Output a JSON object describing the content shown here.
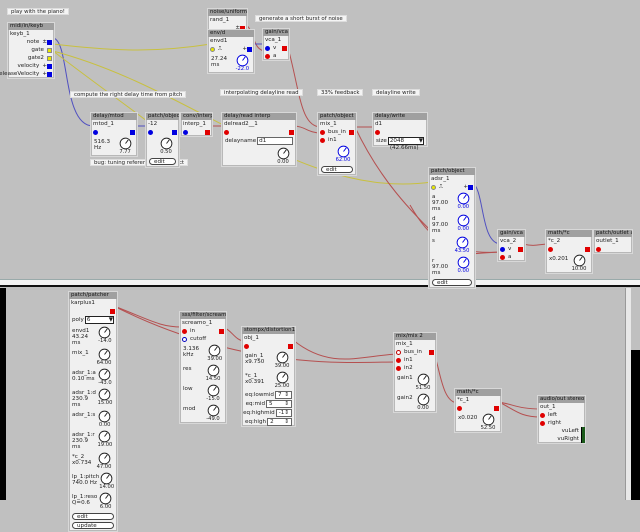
{
  "colors": {
    "background": "#c0c0c0",
    "object": "#f0f0f0",
    "title_bar": "#a0a0a0",
    "audio": "#e00000",
    "frac": "#0000e0",
    "bool": "#e8e800",
    "wire_audio": "#b55050",
    "wire_frac": "#5050c0",
    "wire_bool": "#c8c040"
  },
  "top_patch": {
    "comments": [
      "play with the piano!",
      "generate a short burst of noise",
      "compute the right delay time from pitch",
      "bug: tuning reference is incorrect",
      "interpolating delayline read",
      "33% feedback",
      "delayline write"
    ],
    "objects": [
      {
        "title": "midi/in/keyb",
        "instance": "keyb_1",
        "rows": [
          {
            "kind": "out",
            "label": "note",
            "port": "frac",
            "glyph": "±"
          },
          {
            "kind": "out",
            "label": "gate",
            "port": "bool"
          },
          {
            "kind": "out",
            "label": "gate2",
            "port": "bool"
          },
          {
            "kind": "out",
            "label": "velocity",
            "port": "frac",
            "glyph": "+"
          },
          {
            "kind": "out",
            "label": "releaseVelocity",
            "port": "frac",
            "glyph": "+"
          }
        ]
      },
      {
        "title": "noise/uniform",
        "instance": "rand_1",
        "rows": [
          {
            "kind": "out",
            "label": "",
            "port": "audio",
            "glyph": "±"
          }
        ]
      },
      {
        "title": "env/d",
        "instance": "envd1",
        "rows": [
          {
            "kind": "io",
            "in": "bool",
            "label": "⎍",
            "out": "frac",
            "glyph": "+"
          },
          {
            "kind": "knob",
            "label": "27.24 ms",
            "sub": "",
            "value": "-22.0",
            "blue": true
          }
        ]
      },
      {
        "title": "gain/vca",
        "instance": "vca_1",
        "rows": [
          {
            "kind": "io",
            "in": "frac",
            "label": "v",
            "out": "audio"
          },
          {
            "kind": "in",
            "label": "a",
            "port": "audio"
          }
        ]
      },
      {
        "title": "delay/mtod",
        "instance": "mtod_1",
        "rows": [
          {
            "kind": "io",
            "in": "frac",
            "label": "",
            "out": "frac"
          },
          {
            "kind": "knob",
            "label": "516.3 Hz",
            "sub": "",
            "value": "7.77"
          }
        ]
      },
      {
        "title": "patch/object",
        "instance": "-12",
        "rows": [
          {
            "kind": "io",
            "in": "frac",
            "label": "",
            "out": "frac"
          },
          {
            "kind": "knob",
            "label": "",
            "sub": "",
            "value": "0.50"
          },
          {
            "kind": "button",
            "label": "edit"
          }
        ]
      },
      {
        "title": "conv/interp",
        "instance": "interp_1",
        "rows": [
          {
            "kind": "io",
            "in": "frac",
            "label": "",
            "out": "audio"
          }
        ]
      },
      {
        "title": "delay/read interp",
        "instance": "delread2__1",
        "rows": [
          {
            "kind": "io",
            "in": "audio",
            "label": "",
            "out": "audio"
          },
          {
            "kind": "field",
            "label": "delayname",
            "value": "d1"
          },
          {
            "kind": "knob",
            "label": "",
            "sub": "",
            "value": "0.00"
          }
        ]
      },
      {
        "title": "patch/object",
        "instance": "mix_1",
        "rows": [
          {
            "kind": "io",
            "in": "audio",
            "label": "bus_in",
            "out": "audio"
          },
          {
            "kind": "in",
            "label": "in1",
            "port": "audio"
          },
          {
            "kind": "knob",
            "label": "",
            "sub": "",
            "value": "62.00",
            "blue": true
          },
          {
            "kind": "button",
            "label": "edit"
          }
        ]
      },
      {
        "title": "delay/write",
        "instance": "d1",
        "rows": [
          {
            "kind": "in",
            "label": "",
            "port": "audio"
          },
          {
            "kind": "select",
            "label": "size",
            "value": "2048 (42.66ms)"
          }
        ]
      },
      {
        "title": "patch/object",
        "instance": "adsr_1",
        "rows": [
          {
            "kind": "io",
            "in": "bool",
            "label": "⎍",
            "out": "frac",
            "glyph": "+"
          },
          {
            "kind": "knob",
            "label": "a",
            "sub": "97.00 ms",
            "value": "0.00",
            "blue": true
          },
          {
            "kind": "knob",
            "label": "d",
            "sub": "97.00 ms",
            "value": "0.00",
            "blue": true
          },
          {
            "kind": "knob",
            "label": "",
            "sub": "s",
            "value": "43.50",
            "blue": true
          },
          {
            "kind": "knob",
            "label": "r",
            "sub": "97.00 ms",
            "value": "0.00",
            "blue": true
          },
          {
            "kind": "button",
            "label": "edit"
          }
        ]
      },
      {
        "title": "gain/vca",
        "instance": "vca_2",
        "rows": [
          {
            "kind": "io",
            "in": "frac",
            "label": "v",
            "out": "audio"
          },
          {
            "kind": "in",
            "label": "a",
            "port": "audio"
          }
        ]
      },
      {
        "title": "math/*c",
        "instance": "*c_2",
        "rows": [
          {
            "kind": "io",
            "in": "audio",
            "label": "",
            "out": "audio"
          },
          {
            "kind": "knob",
            "label": "x0.201",
            "sub": "",
            "value": "10.00"
          }
        ]
      },
      {
        "title": "patch/outlet a",
        "instance": "outlet_1",
        "rows": [
          {
            "kind": "in",
            "label": "",
            "port": "audio"
          }
        ]
      }
    ]
  },
  "bottom_patch": {
    "objects": [
      {
        "title": "patch/patcher",
        "instance": "karplus1",
        "rows": [
          {
            "kind": "out",
            "label": "",
            "port": "audio"
          },
          {
            "kind": "select",
            "label": "poly",
            "value": "6"
          },
          {
            "kind": "knob",
            "label": "envd1",
            "sub": "43.24 ms",
            "value": "-14.0"
          },
          {
            "kind": "knob",
            "label": "mix_1",
            "sub": "",
            "value": "64.00"
          },
          {
            "kind": "knob",
            "label": "adsr_1:a",
            "sub": "0.10 ms",
            "value": "-43.0"
          },
          {
            "kind": "knob",
            "label": "adsr_1:d",
            "sub": "230.9 ms",
            "value": "15.00"
          },
          {
            "kind": "knob",
            "label": "adsr_1:s",
            "sub": "",
            "value": "0.00"
          },
          {
            "kind": "knob",
            "label": "adsr_1:r",
            "sub": "230.9 ms",
            "value": "19.00"
          },
          {
            "kind": "knob",
            "label": "*c_2",
            "sub": "x0.734",
            "value": "47.00"
          },
          {
            "kind": "knob",
            "label": "lp_1:pitch",
            "sub": "740.0 Hz",
            "value": "14.00"
          },
          {
            "kind": "knob",
            "label": "lp_1:reso",
            "sub": "Q=0.6",
            "value": "6.00"
          },
          {
            "kind": "button",
            "label": "edit"
          },
          {
            "kind": "button",
            "label": "update"
          }
        ]
      },
      {
        "title": "sss/filter/screamo",
        "instance": "screamo_1",
        "rows": [
          {
            "kind": "io",
            "in": "audio",
            "label": "in",
            "out": "audio"
          },
          {
            "kind": "in",
            "label": "cutoff",
            "port": "openb"
          },
          {
            "kind": "knob",
            "label": "3.136 kHz",
            "sub": "",
            "value": "39.00"
          },
          {
            "kind": "knob",
            "label": "res",
            "sub": "",
            "value": "14.50"
          },
          {
            "kind": "knob",
            "label": "low",
            "sub": "",
            "value": "-15.0"
          },
          {
            "kind": "knob",
            "label": "mod",
            "sub": "",
            "value": "-49.0"
          }
        ]
      },
      {
        "title": "stompx/distortion1",
        "instance": "obj_1",
        "rows": [
          {
            "kind": "io",
            "in": "audio",
            "label": "",
            "out": "audio"
          },
          {
            "kind": "knob",
            "label": "gain_1",
            "sub": "x9.750",
            "value": "39.00"
          },
          {
            "kind": "knob",
            "label": "*c_1",
            "sub": "x0.391",
            "value": "25.00"
          },
          {
            "kind": "spin",
            "label": "eq:lowmid",
            "value": "7"
          },
          {
            "kind": "spin",
            "label": "eq:mid",
            "value": "5"
          },
          {
            "kind": "spin",
            "label": "eq:highmid",
            "value": "-1"
          },
          {
            "kind": "spin",
            "label": "eq:high",
            "value": "2"
          }
        ]
      },
      {
        "title": "mix/mix 2",
        "instance": "mix_1",
        "rows": [
          {
            "kind": "io",
            "in": "open",
            "label": "bus_in",
            "out": "audio"
          },
          {
            "kind": "in",
            "label": "in1",
            "port": "audio"
          },
          {
            "kind": "in",
            "label": "in2",
            "port": "audio"
          },
          {
            "kind": "knob",
            "label": "gain1",
            "sub": "",
            "value": "51.50"
          },
          {
            "kind": "knob",
            "label": "gain2",
            "sub": "",
            "value": "0.00"
          }
        ]
      },
      {
        "title": "math/*c",
        "instance": "*c_1",
        "rows": [
          {
            "kind": "io",
            "in": "audio",
            "label": "",
            "out": "audio"
          },
          {
            "kind": "knob",
            "label": "x0.020",
            "sub": "",
            "value": "52.50"
          }
        ]
      },
      {
        "title": "audio/out stereo",
        "instance": "out_1",
        "rows": [
          {
            "kind": "in",
            "label": "left",
            "port": "audio"
          },
          {
            "kind": "in",
            "label": "right",
            "port": "audio"
          },
          {
            "kind": "vu",
            "label": "vuLeft"
          },
          {
            "kind": "vu",
            "label": "vuRight"
          }
        ]
      }
    ]
  }
}
